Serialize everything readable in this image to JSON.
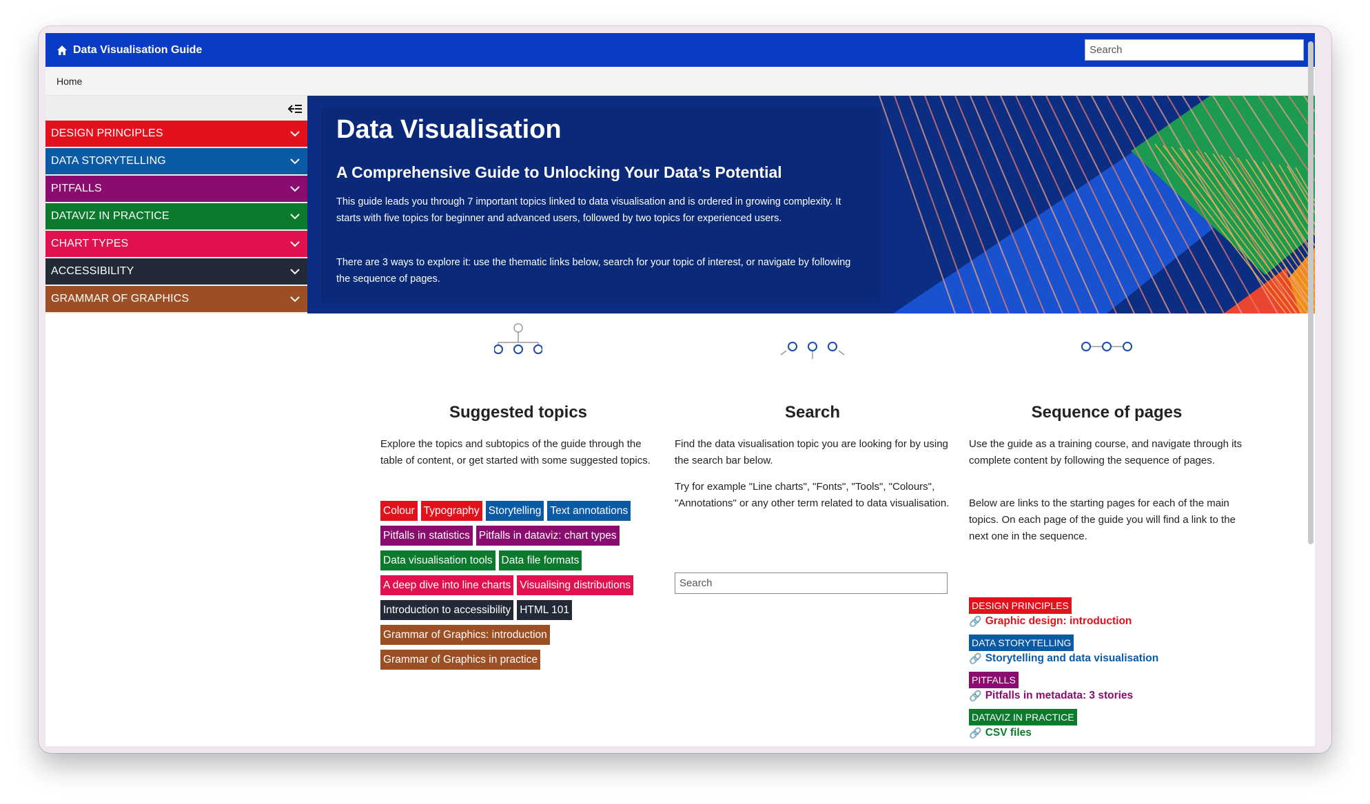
{
  "app": {
    "brand_title": "Data Visualisation Guide",
    "search_placeholder": "Search"
  },
  "breadcrumb": {
    "home": "Home"
  },
  "sidebar": {
    "items": [
      {
        "label": "DESIGN PRINCIPLES",
        "color": "#e3111b"
      },
      {
        "label": "DATA STORYTELLING",
        "color": "#0b5aa6"
      },
      {
        "label": "PITFALLS",
        "color": "#8a0c6e"
      },
      {
        "label": "DATAVIZ IN PRACTICE",
        "color": "#0b7a2c"
      },
      {
        "label": "CHART TYPES",
        "color": "#e0114e"
      },
      {
        "label": "ACCESSIBILITY",
        "color": "#232a37"
      },
      {
        "label": "GRAMMAR OF GRAPHICS",
        "color": "#9c4f24"
      }
    ]
  },
  "hero": {
    "title": "Data Visualisation",
    "subtitle": "A Comprehensive Guide to Unlocking Your Data’s Potential",
    "paragraph1": "This guide leads you through 7 important topics linked to data visualisation and is ordered in growing complexity. It starts with five topics for beginner and advanced users, followed by two topics for experienced users.",
    "paragraph2": "There are 3 ways to explore it: use the thematic links below, search for your topic of interest, or navigate by following the sequence of pages."
  },
  "suggested": {
    "title": "Suggested topics",
    "text": "Explore the topics and subtopics of the guide through the table of content, or get started with some suggested topics.",
    "tag_rows": [
      [
        {
          "label": "Colour",
          "color": "#e3111b"
        },
        {
          "label": "Typography",
          "color": "#e3111b"
        },
        {
          "label": "Storytelling",
          "color": "#0b5aa6"
        },
        {
          "label": "Text annotations",
          "color": "#0b5aa6"
        }
      ],
      [
        {
          "label": "Pitfalls in statistics",
          "color": "#8a0c6e"
        },
        {
          "label": "Pitfalls in dataviz: chart types",
          "color": "#8a0c6e"
        }
      ],
      [
        {
          "label": "Data visualisation tools",
          "color": "#0b7a2c"
        },
        {
          "label": "Data file formats",
          "color": "#0b7a2c"
        }
      ],
      [
        {
          "label": "A deep dive into line charts",
          "color": "#e0114e"
        },
        {
          "label": "Visualising distributions",
          "color": "#e0114e"
        }
      ],
      [
        {
          "label": "Introduction to accessibility",
          "color": "#232a37"
        },
        {
          "label": "HTML 101",
          "color": "#232a37"
        }
      ],
      [
        {
          "label": "Grammar of Graphics: introduction",
          "color": "#9c4f24"
        }
      ],
      [
        {
          "label": "Grammar of Graphics in practice",
          "color": "#9c4f24"
        }
      ]
    ]
  },
  "search": {
    "title": "Search",
    "text1": "Find the data visualisation topic you are looking for by using the search bar below.",
    "text2": "Try for example \"Line charts\", \"Fonts\", \"Tools\", \"Colours\", \"Annotations\" or any other term related to data visualisation.",
    "placeholder": "Search"
  },
  "sequence": {
    "title": "Sequence of pages",
    "text1": "Use the guide as a training course, and navigate through its complete content by following the sequence of pages.",
    "text2": "Below are links to the starting pages for each of the main topics. On each page of the guide you will find a link to the next one in the sequence.",
    "items": [
      {
        "badge": "DESIGN PRINCIPLES",
        "link": "Graphic design: introduction",
        "color": "#e3111b"
      },
      {
        "badge": "DATA STORYTELLING",
        "link": "Storytelling and data visualisation",
        "color": "#0b5aa6"
      },
      {
        "badge": "PITFALLS",
        "link": "Pitfalls in metadata: 3 stories",
        "color": "#8a0c6e"
      },
      {
        "badge": "DATAVIZ IN PRACTICE",
        "link": "CSV files",
        "color": "#0b7a2c"
      }
    ],
    "partial_badge_color": "#e0114e"
  }
}
